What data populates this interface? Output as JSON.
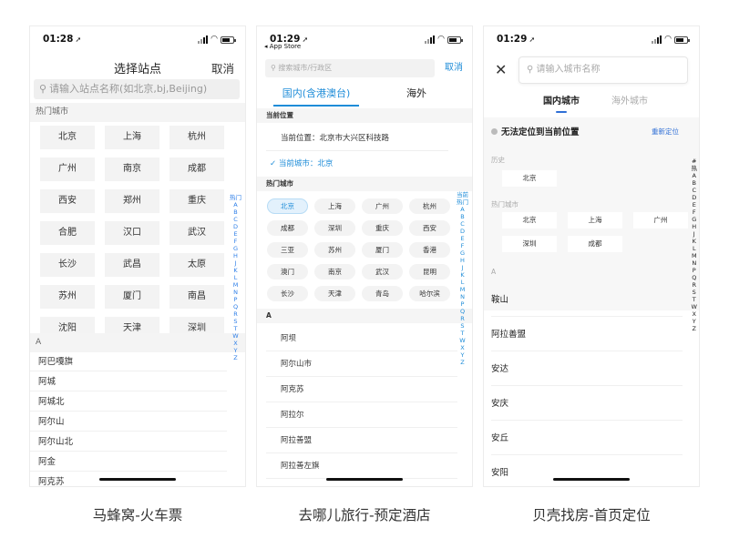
{
  "panels": [
    {
      "time": "01:28",
      "title": "选择站点",
      "cancel": "取消",
      "search_placeholder": "请输入站点名称(如北京,bj,Beijing)",
      "hot_label": "热门城市",
      "hot_cities": [
        "北京",
        "上海",
        "杭州",
        "广州",
        "南京",
        "成都",
        "西安",
        "郑州",
        "重庆",
        "合肥",
        "汉口",
        "武汉",
        "长沙",
        "武昌",
        "太原",
        "苏州",
        "厦门",
        "南昌",
        "沈阳",
        "天津",
        "深圳"
      ],
      "section_a": "A",
      "a_list": [
        "阿巴嘎旗",
        "阿城",
        "阿城北",
        "阿尔山",
        "阿尔山北",
        "阿金",
        "阿克苏"
      ],
      "index": [
        "热门",
        "A",
        "B",
        "C",
        "D",
        "E",
        "F",
        "G",
        "H",
        "J",
        "K",
        "L",
        "M",
        "N",
        "P",
        "Q",
        "R",
        "S",
        "T",
        "W",
        "X",
        "Y",
        "Z"
      ],
      "caption": "马蜂窝-火车票"
    },
    {
      "time": "01:29",
      "back_label": "◂ App Store",
      "search_placeholder": "搜索城市/行政区",
      "cancel": "取消",
      "tab_domestic": "国内(含港澳台)",
      "tab_overseas": "海外",
      "current_section": "当前位置",
      "current_location": "当前位置：北京市大兴区科技路",
      "current_city": "当前城市：北京",
      "hot_label": "热门城市",
      "hot_cities": [
        "北京",
        "上海",
        "广州",
        "杭州",
        "成都",
        "深圳",
        "重庆",
        "西安",
        "三亚",
        "苏州",
        "厦门",
        "香港",
        "澳门",
        "南京",
        "武汉",
        "昆明",
        "长沙",
        "天津",
        "青岛",
        "哈尔滨"
      ],
      "section_a": "A",
      "a_list": [
        "阿坝",
        "阿尔山市",
        "阿克苏",
        "阿拉尔",
        "阿拉善盟",
        "阿拉善左旗",
        "阿勒泰"
      ],
      "index": [
        "当前",
        "热门",
        "A",
        "B",
        "C",
        "D",
        "E",
        "F",
        "G",
        "H",
        "J",
        "K",
        "L",
        "M",
        "N",
        "P",
        "Q",
        "R",
        "S",
        "T",
        "W",
        "X",
        "Y",
        "Z"
      ],
      "caption": "去哪儿旅行-预定酒店"
    },
    {
      "time": "01:29",
      "close_label": "✕",
      "search_placeholder": "请输入城市名称",
      "tab_domestic": "国内城市",
      "tab_overseas": "海外城市",
      "locate_fail": "无法定位到当前位置",
      "relocate": "重新定位",
      "history_label": "历史",
      "history": [
        "北京"
      ],
      "hot_label": "热门城市",
      "hot_cities": [
        "北京",
        "上海",
        "广州",
        "深圳",
        "成都"
      ],
      "section_a": "A",
      "a_list": [
        "鞍山",
        "阿拉善盟",
        "安达",
        "安庆",
        "安丘",
        "安阳"
      ],
      "index": [
        "#",
        "热",
        "A",
        "B",
        "C",
        "D",
        "E",
        "F",
        "G",
        "H",
        "J",
        "K",
        "L",
        "M",
        "N",
        "P",
        "Q",
        "R",
        "S",
        "T",
        "W",
        "X",
        "Y",
        "Z"
      ],
      "caption": "贝壳找房-首页定位"
    }
  ],
  "colors": {
    "qunar_blue": "#1e8cd8",
    "beike_blue": "#2f6fd6",
    "mafengwo_index": "#2d7ee8"
  }
}
